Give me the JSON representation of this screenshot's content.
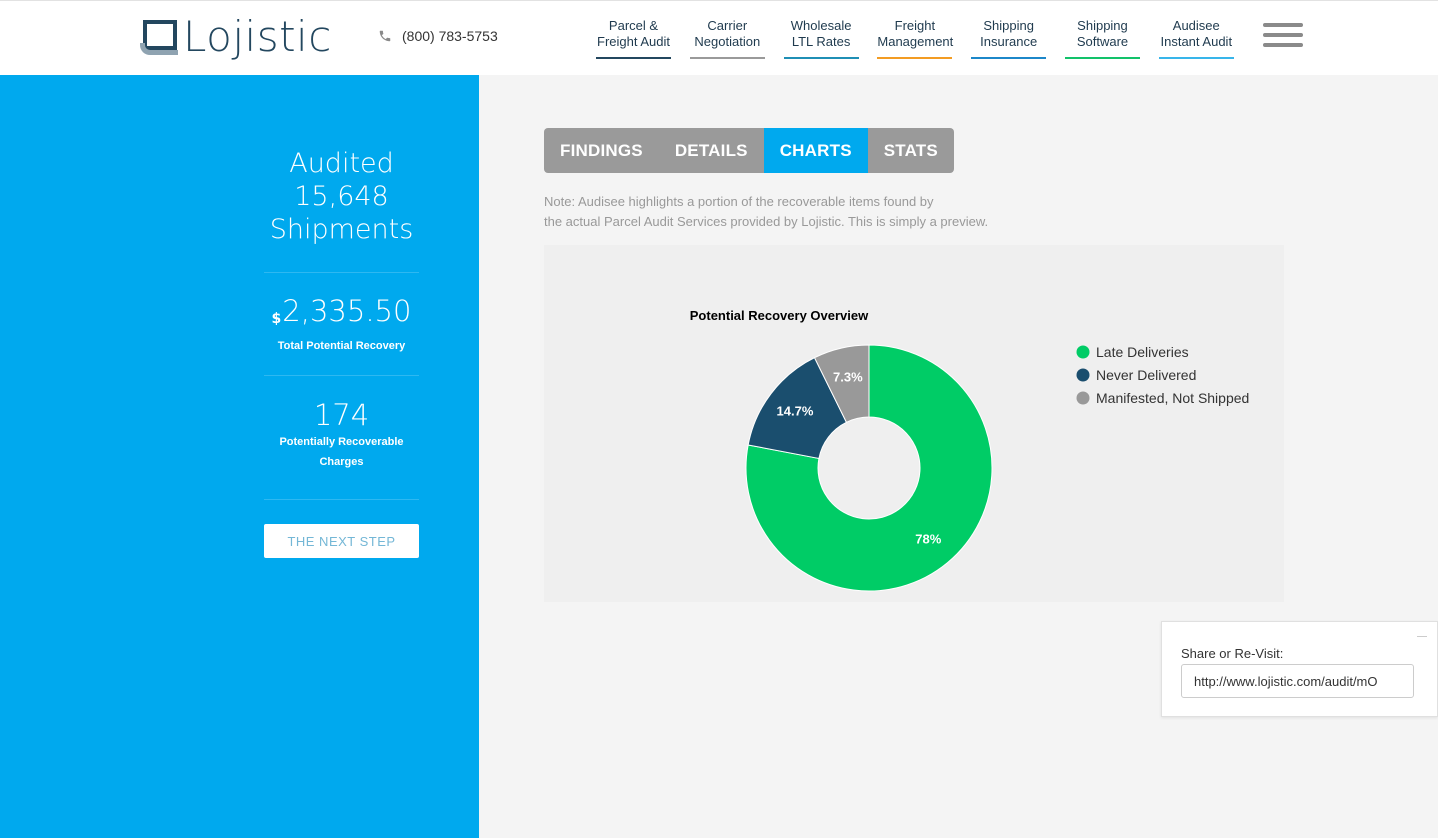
{
  "brand": {
    "logo_text": "Lojistic"
  },
  "phone": "(800) 783-5753",
  "nav": [
    {
      "line1": "Parcel &",
      "line2": "Freight Audit",
      "underline": "#23475f"
    },
    {
      "line1": "Carrier",
      "line2": "Negotiation",
      "underline": "#9a9a9a"
    },
    {
      "line1": "Wholesale",
      "line2": "LTL Rates",
      "underline": "#1f8fb5"
    },
    {
      "line1": "Freight",
      "line2": "Management",
      "underline": "#f39c23"
    },
    {
      "line1": "Shipping",
      "line2": "Insurance",
      "underline": "#1c87c9"
    },
    {
      "line1": "Shipping",
      "line2": "Software",
      "underline": "#12c26a"
    },
    {
      "line1": "Audisee",
      "line2": "Instant Audit",
      "underline": "#38b5ea"
    }
  ],
  "summary": {
    "audited_line1": "Audited",
    "audited_count": "15,648",
    "audited_line3": "Shipments",
    "recovery_currency": "$",
    "recovery_value": "2,335.50",
    "recovery_label": "Total Potential Recovery",
    "charges_value": "174",
    "charges_label": "Potentially Recoverable Charges",
    "next_step_label": "THE NEXT STEP"
  },
  "tabs": [
    {
      "label": "FINDINGS",
      "active": false
    },
    {
      "label": "DETAILS",
      "active": false
    },
    {
      "label": "CHARTS",
      "active": true
    },
    {
      "label": "STATS",
      "active": false
    }
  ],
  "note": {
    "line1": "Note: Audisee highlights a portion of the recoverable items found by",
    "line2": "the actual Parcel Audit Services provided by Lojistic. This is simply a preview."
  },
  "chart_data": {
    "type": "pie",
    "title": "Potential Recovery Overview",
    "donut": true,
    "legend_position": "right",
    "series": [
      {
        "name": "Late Deliveries",
        "value": 78,
        "label": "78%",
        "color": "#00cc66"
      },
      {
        "name": "Never Delivered",
        "value": 14.7,
        "label": "14.7%",
        "color": "#1a4e6e"
      },
      {
        "name": "Manifested, Not Shipped",
        "value": 7.3,
        "label": "7.3%",
        "color": "#999999"
      }
    ]
  },
  "share": {
    "label": "Share or Re-Visit:",
    "url": "http://www.lojistic.com/audit/mO"
  }
}
